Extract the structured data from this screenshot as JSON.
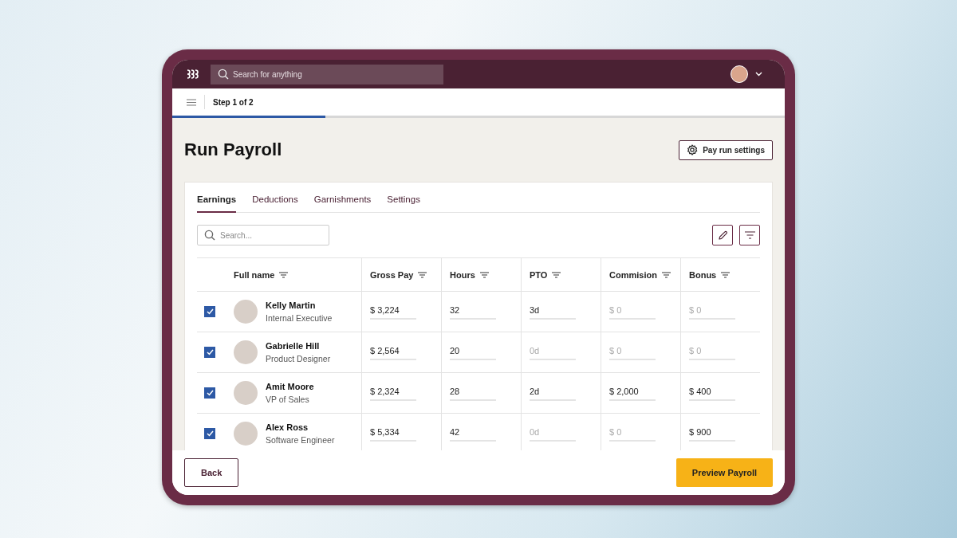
{
  "topbar": {
    "search": {
      "placeholder": "Search for anything"
    }
  },
  "stepbar": {
    "step": "Step 1 of 2",
    "level": 0.25
  },
  "page": {
    "title": "Run Payroll",
    "settings_button": "Pay run settings"
  },
  "tabs": [
    {
      "label": "Earnings",
      "selected": true
    },
    {
      "label": "Deductions",
      "selected": false
    },
    {
      "label": "Garnishments",
      "selected": false
    },
    {
      "label": "Settings",
      "selected": false
    }
  ],
  "table_search": {
    "placeholder": "Search..."
  },
  "table": {
    "columns": [
      "Full name",
      "Gross Pay",
      "Hours",
      "PTO",
      "Commision",
      "Bonus"
    ],
    "rows": [
      {
        "checked": true,
        "cells": [
          {
            "kind": "person",
            "name": "Kelly Martin",
            "role": "Internal Executive"
          },
          {
            "value": "$ 3,224"
          },
          {
            "value": "32"
          },
          {
            "value": "3d"
          },
          {
            "placeholder": "$ 0"
          },
          {
            "placeholder": "$ 0"
          }
        ]
      },
      {
        "checked": true,
        "cells": [
          {
            "kind": "person",
            "name": "Gabrielle Hill",
            "role": "Product Designer"
          },
          {
            "value": "$ 2,564"
          },
          {
            "value": "20"
          },
          {
            "placeholder": "0d"
          },
          {
            "placeholder": "$ 0"
          },
          {
            "placeholder": "$ 0"
          }
        ]
      },
      {
        "checked": true,
        "cells": [
          {
            "kind": "person",
            "name": "Amit Moore",
            "role": "VP of Sales"
          },
          {
            "value": "$ 2,324"
          },
          {
            "value": "28"
          },
          {
            "value": "2d"
          },
          {
            "value": "$ 2,000"
          },
          {
            "value": "$ 400"
          }
        ]
      },
      {
        "checked": true,
        "cells": [
          {
            "kind": "person",
            "name": "Alex Ross",
            "role": "Software Engineer"
          },
          {
            "value": "$ 5,334"
          },
          {
            "value": "42"
          },
          {
            "placeholder": "0d"
          },
          {
            "placeholder": "$ 0"
          },
          {
            "value": "$ 900"
          }
        ]
      }
    ]
  },
  "footer": {
    "back": "Back",
    "preview": "Preview Payroll"
  }
}
